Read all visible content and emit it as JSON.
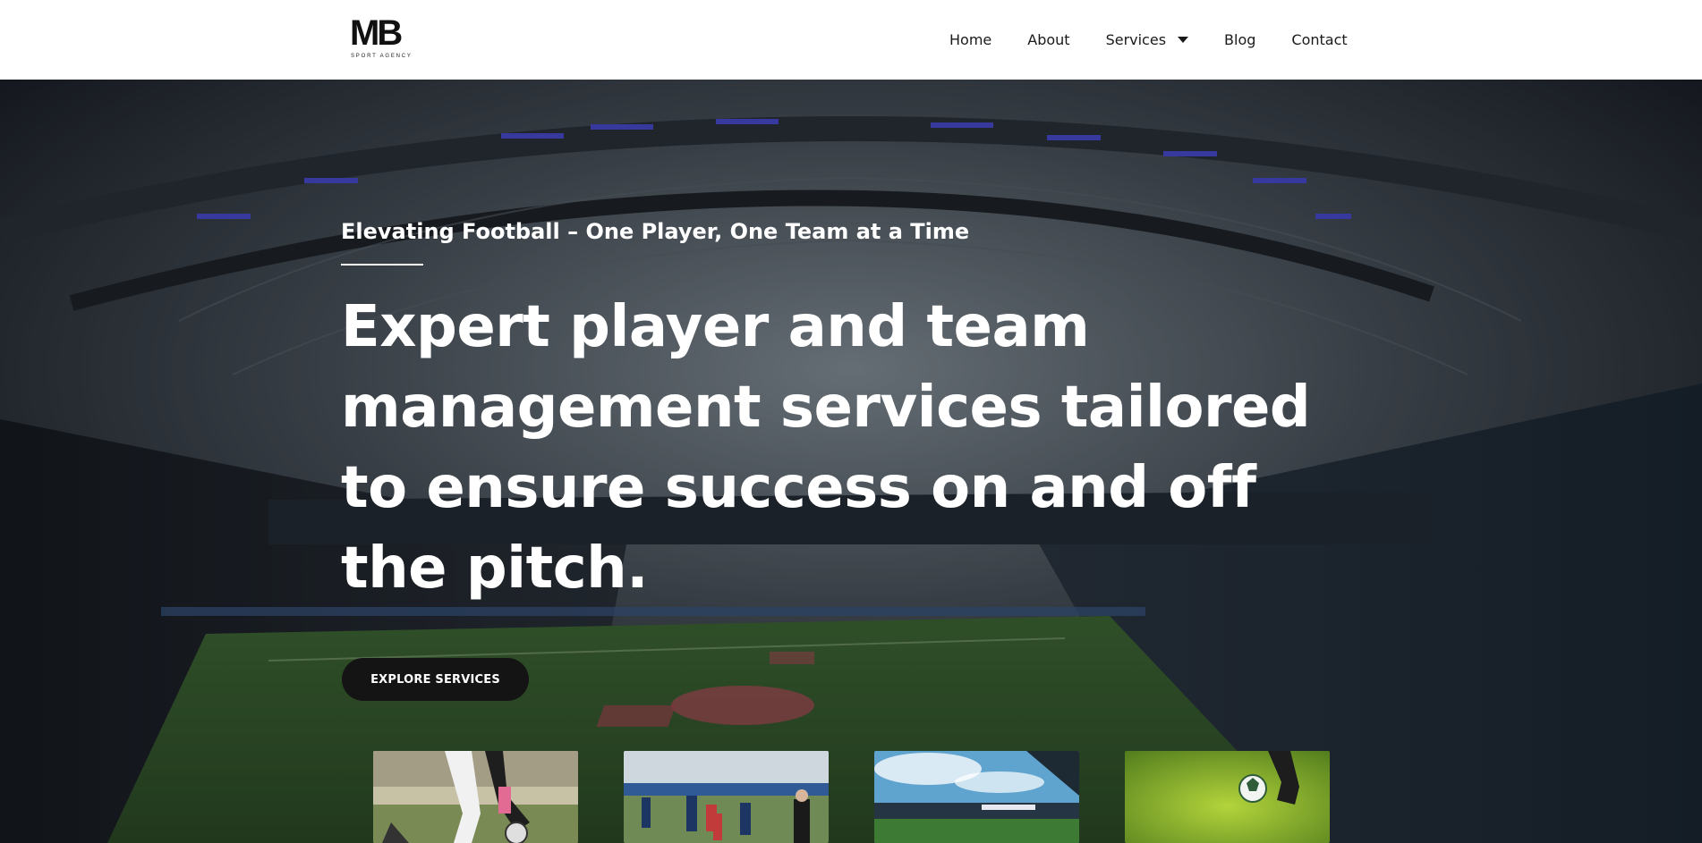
{
  "brand": {
    "logo_text": "MB",
    "tagline": "SPORT AGENCY"
  },
  "nav": {
    "items": [
      {
        "label": "Home"
      },
      {
        "label": "About"
      },
      {
        "label": "Services"
      },
      {
        "label": "Blog"
      },
      {
        "label": "Contact"
      }
    ]
  },
  "hero": {
    "subtitle": "Elevating Football – One Player, One Team at a Time",
    "headline": "Expert player and team management services tailored to ensure success on and off the pitch.",
    "cta_label": "EXPLORE SERVICES"
  },
  "gallery": {
    "items": [
      {
        "icon": "legs-kicking-ball-image"
      },
      {
        "icon": "team-warmup-image"
      },
      {
        "icon": "stadium-sky-image"
      },
      {
        "icon": "ball-on-grass-image"
      }
    ]
  },
  "colors": {
    "accent_dark": "#141414",
    "nav_text": "#1a1a1a",
    "hero_text": "#ffffff"
  }
}
